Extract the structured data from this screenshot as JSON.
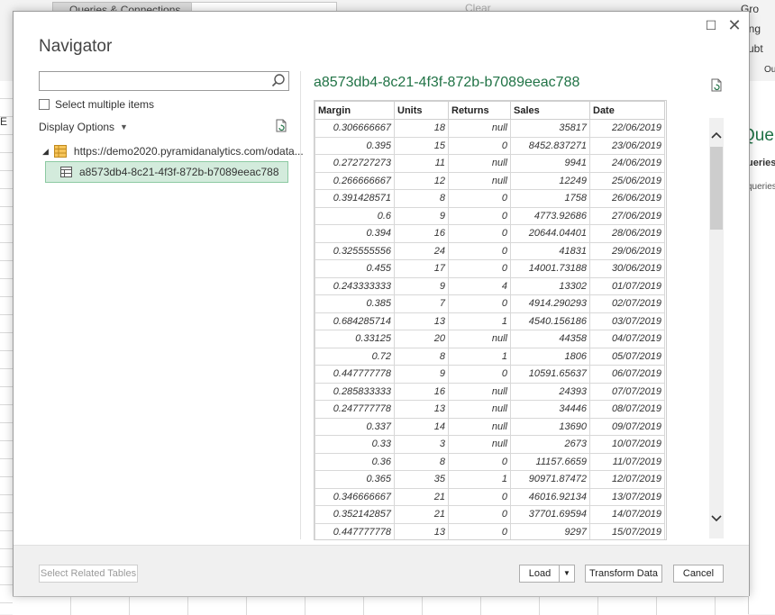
{
  "ribbon": {
    "queries_connections": "Queries & Connections",
    "clear": "Clear",
    "right_items": [
      "Gro",
      "Ung",
      "Subt",
      "Ou"
    ]
  },
  "excel": {
    "column_label": "E",
    "pane_title": "Quer",
    "pane_tab1": "ueries",
    "pane_tab2": "queries"
  },
  "dialog": {
    "title": "Navigator",
    "search_placeholder": "",
    "select_multiple_label": "Select multiple items",
    "display_options_label": "Display Options",
    "tree": {
      "root_label": "https://demo2020.pyramidanalytics.com/odata...",
      "child_label": "a8573db4-8c21-4f3f-872b-b7089eeac788"
    },
    "preview": {
      "title": "a8573db4-8c21-4f3f-872b-b7089eeac788",
      "columns": [
        "Margin",
        "Units",
        "Returns",
        "Sales",
        "Date"
      ],
      "rows": [
        [
          "0.306666667",
          "18",
          "null",
          "35817",
          "22/06/2019"
        ],
        [
          "0.395",
          "15",
          "0",
          "8452.837271",
          "23/06/2019"
        ],
        [
          "0.272727273",
          "11",
          "null",
          "9941",
          "24/06/2019"
        ],
        [
          "0.266666667",
          "12",
          "null",
          "12249",
          "25/06/2019"
        ],
        [
          "0.391428571",
          "8",
          "0",
          "1758",
          "26/06/2019"
        ],
        [
          "0.6",
          "9",
          "0",
          "4773.92686",
          "27/06/2019"
        ],
        [
          "0.394",
          "16",
          "0",
          "20644.04401",
          "28/06/2019"
        ],
        [
          "0.325555556",
          "24",
          "0",
          "41831",
          "29/06/2019"
        ],
        [
          "0.455",
          "17",
          "0",
          "14001.73188",
          "30/06/2019"
        ],
        [
          "0.243333333",
          "9",
          "4",
          "13302",
          "01/07/2019"
        ],
        [
          "0.385",
          "7",
          "0",
          "4914.290293",
          "02/07/2019"
        ],
        [
          "0.684285714",
          "13",
          "1",
          "4540.156186",
          "03/07/2019"
        ],
        [
          "0.33125",
          "20",
          "null",
          "44358",
          "04/07/2019"
        ],
        [
          "0.72",
          "8",
          "1",
          "1806",
          "05/07/2019"
        ],
        [
          "0.447777778",
          "9",
          "0",
          "10591.65637",
          "06/07/2019"
        ],
        [
          "0.285833333",
          "16",
          "null",
          "24393",
          "07/07/2019"
        ],
        [
          "0.247777778",
          "13",
          "null",
          "34446",
          "08/07/2019"
        ],
        [
          "0.337",
          "14",
          "null",
          "13690",
          "09/07/2019"
        ],
        [
          "0.33",
          "3",
          "null",
          "2673",
          "10/07/2019"
        ],
        [
          "0.36",
          "8",
          "0",
          "11157.6659",
          "11/07/2019"
        ],
        [
          "0.365",
          "35",
          "1",
          "90971.87472",
          "12/07/2019"
        ],
        [
          "0.346666667",
          "21",
          "0",
          "46016.92134",
          "13/07/2019"
        ],
        [
          "0.352142857",
          "21",
          "0",
          "37701.69594",
          "14/07/2019"
        ],
        [
          "0.447777778",
          "13",
          "0",
          "9297",
          "15/07/2019"
        ]
      ]
    },
    "footer": {
      "select_related_label": "Select Related Tables",
      "load_label": "Load",
      "transform_label": "Transform Data",
      "cancel_label": "Cancel"
    }
  },
  "colors": {
    "accent_green": "#217346",
    "selection_fill": "#d3ebdc",
    "selection_border": "#8cc9a2"
  }
}
